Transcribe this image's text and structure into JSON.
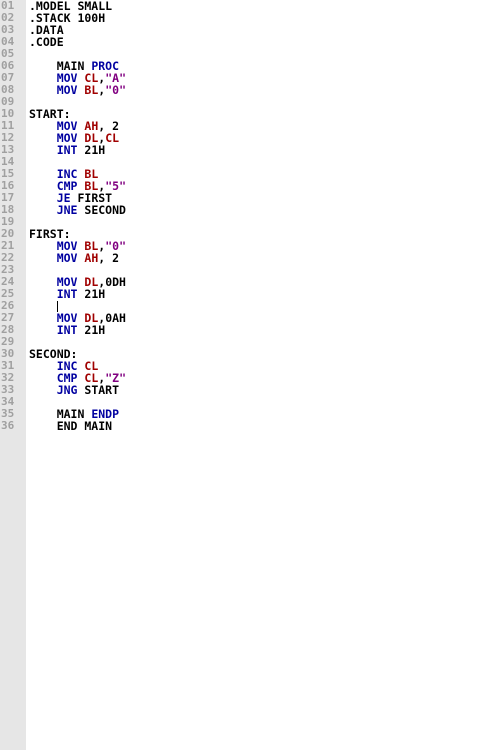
{
  "colors": {
    "keyword": "#0000a0",
    "register": "#a00000",
    "string": "#800080",
    "plain": "#000000",
    "gutter_bg": "#e6e6e6",
    "gutter_text": "#a0a0a0"
  },
  "editor": {
    "caret_line": 26,
    "lines": [
      {
        "num": "01",
        "tokens": [
          {
            "text": ".MODEL SMALL",
            "type": "plain"
          }
        ]
      },
      {
        "num": "02",
        "tokens": [
          {
            "text": ".STACK 100H",
            "type": "plain"
          }
        ]
      },
      {
        "num": "03",
        "tokens": [
          {
            "text": ".DATA",
            "type": "plain"
          }
        ]
      },
      {
        "num": "04",
        "tokens": [
          {
            "text": ".CODE",
            "type": "plain"
          }
        ]
      },
      {
        "num": "05",
        "tokens": []
      },
      {
        "num": "06",
        "tokens": [
          {
            "text": "    MAIN ",
            "type": "plain"
          },
          {
            "text": "PROC",
            "type": "keyword"
          }
        ]
      },
      {
        "num": "07",
        "tokens": [
          {
            "text": "    ",
            "type": "plain"
          },
          {
            "text": "MOV",
            "type": "keyword"
          },
          {
            "text": " ",
            "type": "plain"
          },
          {
            "text": "CL",
            "type": "register"
          },
          {
            "text": ",",
            "type": "plain"
          },
          {
            "text": "\"A\"",
            "type": "string"
          }
        ]
      },
      {
        "num": "08",
        "tokens": [
          {
            "text": "    ",
            "type": "plain"
          },
          {
            "text": "MOV",
            "type": "keyword"
          },
          {
            "text": " ",
            "type": "plain"
          },
          {
            "text": "BL",
            "type": "register"
          },
          {
            "text": ",",
            "type": "plain"
          },
          {
            "text": "\"0\"",
            "type": "string"
          }
        ]
      },
      {
        "num": "09",
        "tokens": []
      },
      {
        "num": "10",
        "tokens": [
          {
            "text": "START:",
            "type": "plain"
          }
        ]
      },
      {
        "num": "11",
        "tokens": [
          {
            "text": "    ",
            "type": "plain"
          },
          {
            "text": "MOV",
            "type": "keyword"
          },
          {
            "text": " ",
            "type": "plain"
          },
          {
            "text": "AH",
            "type": "register"
          },
          {
            "text": ", 2",
            "type": "plain"
          }
        ]
      },
      {
        "num": "12",
        "tokens": [
          {
            "text": "    ",
            "type": "plain"
          },
          {
            "text": "MOV",
            "type": "keyword"
          },
          {
            "text": " ",
            "type": "plain"
          },
          {
            "text": "DL",
            "type": "register"
          },
          {
            "text": ",",
            "type": "plain"
          },
          {
            "text": "CL",
            "type": "register"
          }
        ]
      },
      {
        "num": "13",
        "tokens": [
          {
            "text": "    ",
            "type": "plain"
          },
          {
            "text": "INT",
            "type": "keyword"
          },
          {
            "text": " 21H",
            "type": "plain"
          }
        ]
      },
      {
        "num": "14",
        "tokens": []
      },
      {
        "num": "15",
        "tokens": [
          {
            "text": "    ",
            "type": "plain"
          },
          {
            "text": "INC",
            "type": "keyword"
          },
          {
            "text": " ",
            "type": "plain"
          },
          {
            "text": "BL",
            "type": "register"
          }
        ]
      },
      {
        "num": "16",
        "tokens": [
          {
            "text": "    ",
            "type": "plain"
          },
          {
            "text": "CMP",
            "type": "keyword"
          },
          {
            "text": " ",
            "type": "plain"
          },
          {
            "text": "BL",
            "type": "register"
          },
          {
            "text": ",",
            "type": "plain"
          },
          {
            "text": "\"5\"",
            "type": "string"
          }
        ]
      },
      {
        "num": "17",
        "tokens": [
          {
            "text": "    ",
            "type": "plain"
          },
          {
            "text": "JE",
            "type": "keyword"
          },
          {
            "text": " FIRST",
            "type": "plain"
          }
        ]
      },
      {
        "num": "18",
        "tokens": [
          {
            "text": "    ",
            "type": "plain"
          },
          {
            "text": "JNE",
            "type": "keyword"
          },
          {
            "text": " SECOND",
            "type": "plain"
          }
        ]
      },
      {
        "num": "19",
        "tokens": []
      },
      {
        "num": "20",
        "tokens": [
          {
            "text": "FIRST:",
            "type": "plain"
          }
        ]
      },
      {
        "num": "21",
        "tokens": [
          {
            "text": "    ",
            "type": "plain"
          },
          {
            "text": "MOV",
            "type": "keyword"
          },
          {
            "text": " ",
            "type": "plain"
          },
          {
            "text": "BL",
            "type": "register"
          },
          {
            "text": ",",
            "type": "plain"
          },
          {
            "text": "\"0\"",
            "type": "string"
          }
        ]
      },
      {
        "num": "22",
        "tokens": [
          {
            "text": "    ",
            "type": "plain"
          },
          {
            "text": "MOV",
            "type": "keyword"
          },
          {
            "text": " ",
            "type": "plain"
          },
          {
            "text": "AH",
            "type": "register"
          },
          {
            "text": ", 2",
            "type": "plain"
          }
        ]
      },
      {
        "num": "23",
        "tokens": []
      },
      {
        "num": "24",
        "tokens": [
          {
            "text": "    ",
            "type": "plain"
          },
          {
            "text": "MOV",
            "type": "keyword"
          },
          {
            "text": " ",
            "type": "plain"
          },
          {
            "text": "DL",
            "type": "register"
          },
          {
            "text": ",0DH",
            "type": "plain"
          }
        ]
      },
      {
        "num": "25",
        "tokens": [
          {
            "text": "    ",
            "type": "plain"
          },
          {
            "text": "INT",
            "type": "keyword"
          },
          {
            "text": " 21H",
            "type": "plain"
          }
        ]
      },
      {
        "num": "26",
        "tokens": [
          {
            "text": "    ",
            "type": "plain"
          }
        ]
      },
      {
        "num": "27",
        "tokens": [
          {
            "text": "    ",
            "type": "plain"
          },
          {
            "text": "MOV",
            "type": "keyword"
          },
          {
            "text": " ",
            "type": "plain"
          },
          {
            "text": "DL",
            "type": "register"
          },
          {
            "text": ",0AH",
            "type": "plain"
          }
        ]
      },
      {
        "num": "28",
        "tokens": [
          {
            "text": "    ",
            "type": "plain"
          },
          {
            "text": "INT",
            "type": "keyword"
          },
          {
            "text": " 21H",
            "type": "plain"
          }
        ]
      },
      {
        "num": "29",
        "tokens": []
      },
      {
        "num": "30",
        "tokens": [
          {
            "text": "SECOND:",
            "type": "plain"
          }
        ]
      },
      {
        "num": "31",
        "tokens": [
          {
            "text": "    ",
            "type": "plain"
          },
          {
            "text": "INC",
            "type": "keyword"
          },
          {
            "text": " ",
            "type": "plain"
          },
          {
            "text": "CL",
            "type": "register"
          }
        ]
      },
      {
        "num": "32",
        "tokens": [
          {
            "text": "    ",
            "type": "plain"
          },
          {
            "text": "CMP",
            "type": "keyword"
          },
          {
            "text": " ",
            "type": "plain"
          },
          {
            "text": "CL",
            "type": "register"
          },
          {
            "text": ",",
            "type": "plain"
          },
          {
            "text": "\"Z\"",
            "type": "string"
          }
        ]
      },
      {
        "num": "33",
        "tokens": [
          {
            "text": "    ",
            "type": "plain"
          },
          {
            "text": "JNG",
            "type": "keyword"
          },
          {
            "text": " START",
            "type": "plain"
          }
        ]
      },
      {
        "num": "34",
        "tokens": []
      },
      {
        "num": "35",
        "tokens": [
          {
            "text": "    MAIN ",
            "type": "plain"
          },
          {
            "text": "ENDP",
            "type": "keyword"
          }
        ]
      },
      {
        "num": "36",
        "tokens": [
          {
            "text": "    END MAIN",
            "type": "plain"
          }
        ]
      }
    ]
  }
}
